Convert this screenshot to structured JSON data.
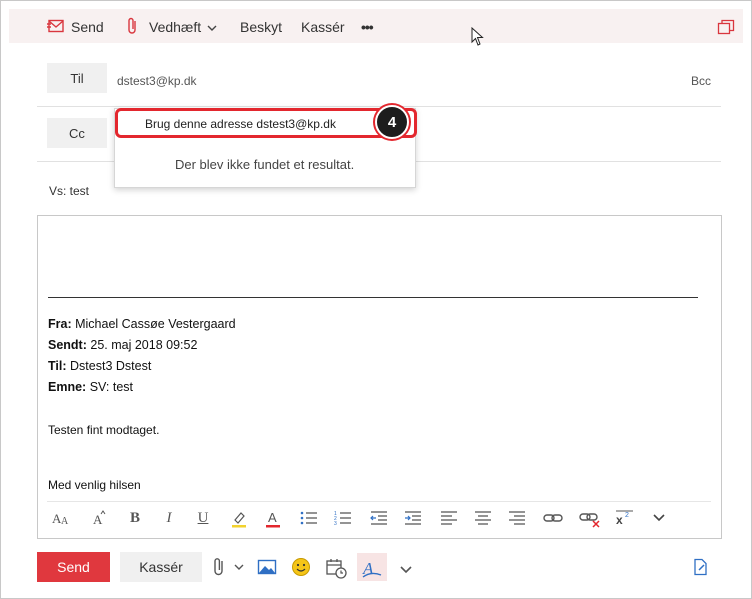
{
  "toolbar": {
    "send": "Send",
    "attach": "Vedhæft",
    "protect": "Beskyt",
    "discard": "Kassér",
    "more": "•••"
  },
  "to": {
    "label": "Til",
    "address": "dstest3@kp.dk",
    "bcc": "Bcc"
  },
  "cc": {
    "label": "Cc"
  },
  "suggestion": {
    "use_address": "Brug denne adresse dstest3@kp.dk",
    "no_result": "Der blev ikke fundet et resultat.",
    "step_badge": "4"
  },
  "subject": "Vs: test",
  "quoted": {
    "from_label": "Fra:",
    "from_value": "Michael Cassøe Vestergaard",
    "sent_label": "Sendt:",
    "sent_value": "25. maj 2018 09:52",
    "to_label": "Til:",
    "to_value": "Dstest3 Dstest",
    "subject_label": "Emne:",
    "subject_value": "SV: test",
    "line1": "Testen fint modtaget.",
    "line2": "Med venlig hilsen"
  },
  "footer": {
    "send": "Send",
    "discard": "Kassér"
  },
  "colors": {
    "accent": "#e0383e",
    "highlight": "#e3272e"
  }
}
